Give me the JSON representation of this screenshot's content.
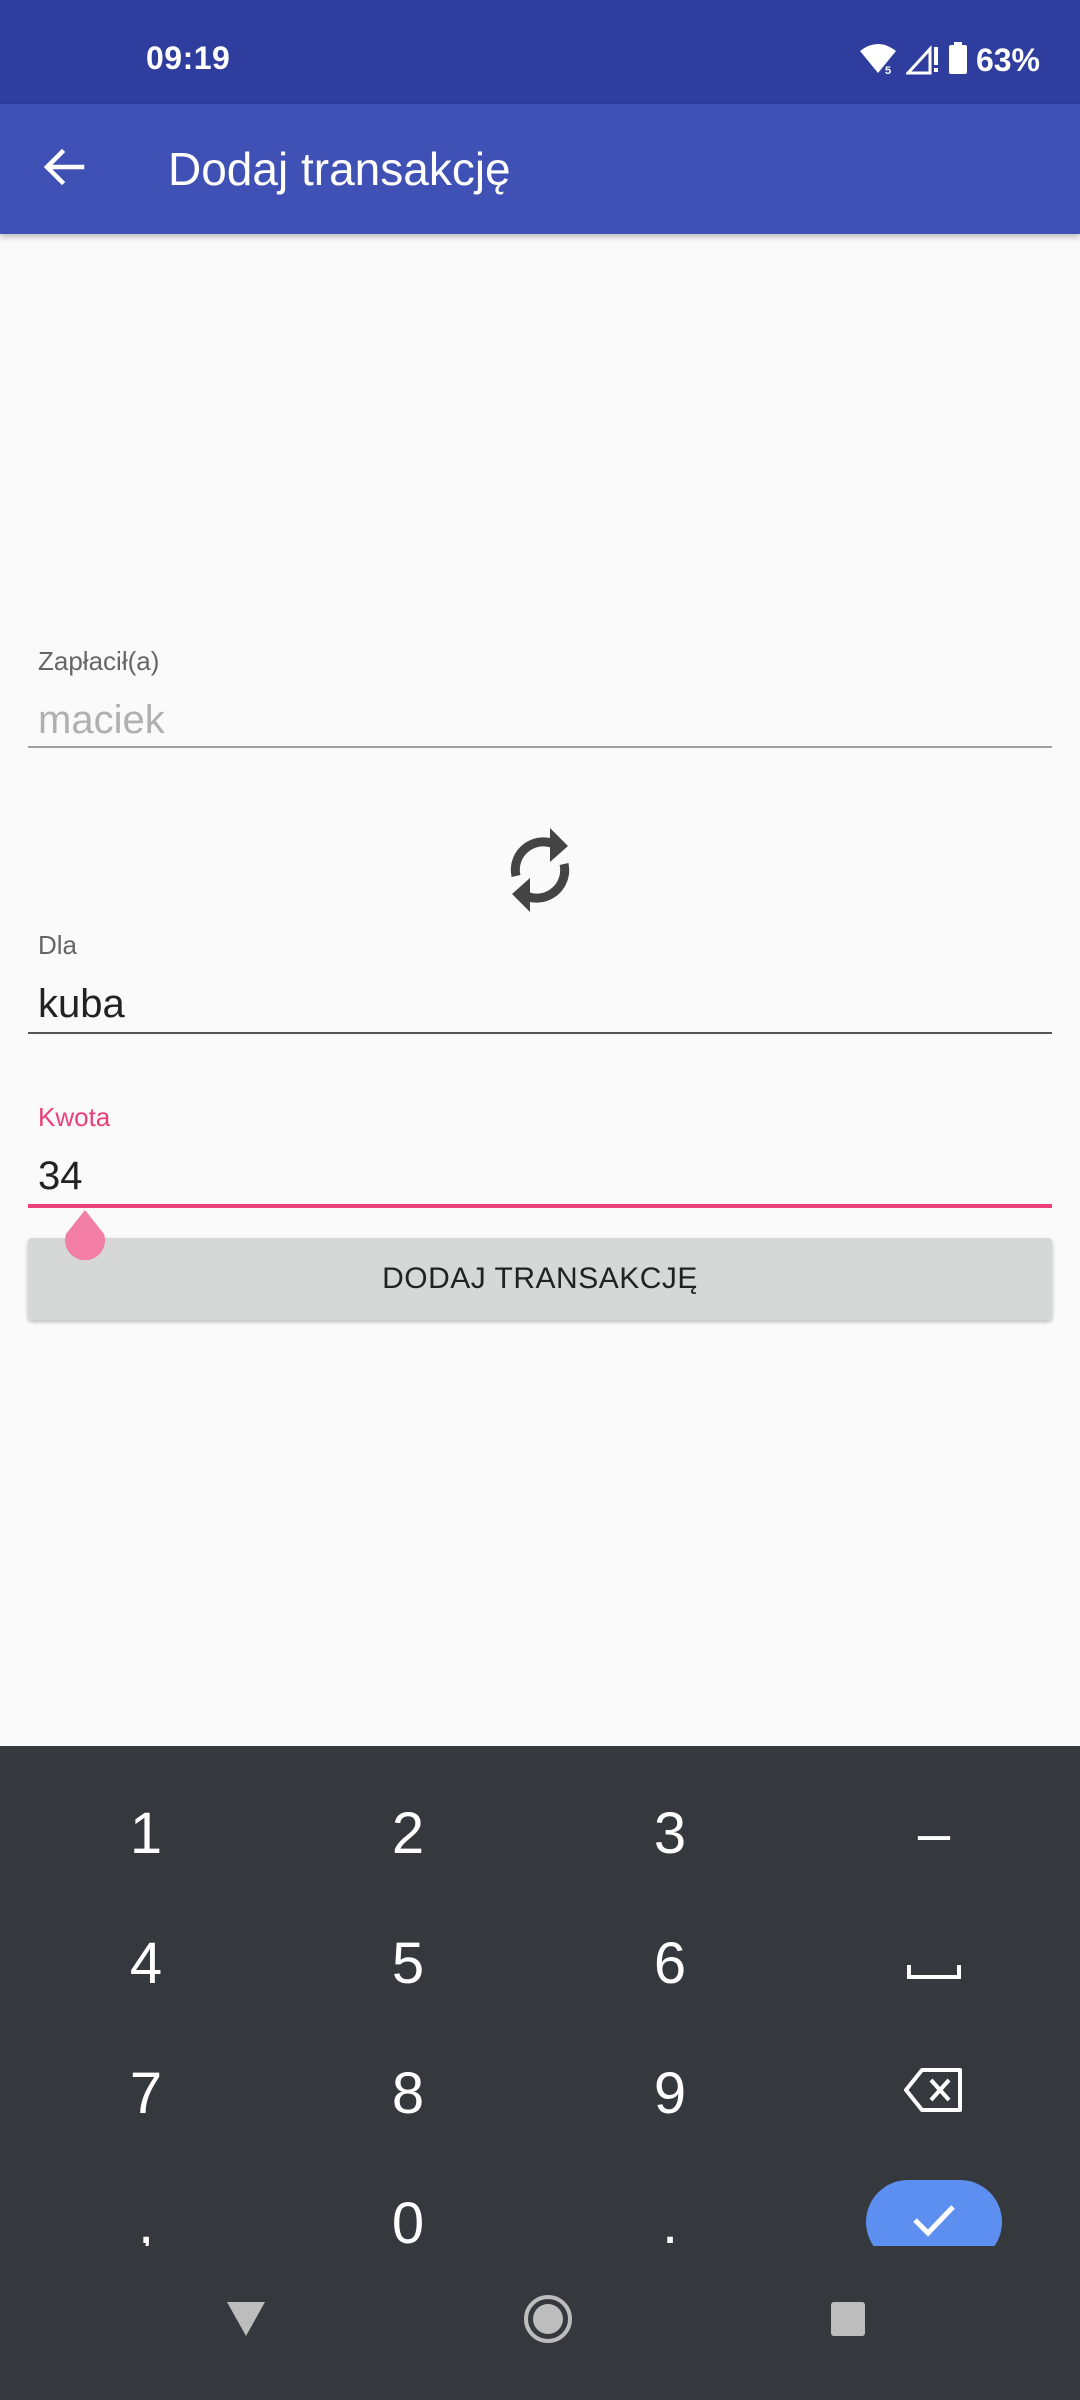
{
  "status": {
    "time": "09:19",
    "battery_pct": "63%",
    "icons": [
      "wifi-icon",
      "signal-icon",
      "battery-icon"
    ]
  },
  "appbar": {
    "back_icon": "arrow-back-icon",
    "title": "Dodaj transakcję"
  },
  "form": {
    "payer_label": "Zapłacił(a)",
    "payer_value": "maciek",
    "swap_icon": "swap-refresh-icon",
    "recipient_label": "Dla",
    "recipient_value": "kuba",
    "amount_label": "Kwota",
    "amount_value": "34",
    "submit_label": "DODAJ TRANSAKCJĘ"
  },
  "keyboard": {
    "rows": [
      [
        "1",
        "2",
        "3",
        "–"
      ],
      [
        "4",
        "5",
        "6",
        "space-icon"
      ],
      [
        "7",
        "8",
        "9",
        "backspace-icon"
      ],
      [
        ",",
        "0",
        ".",
        "done-check-icon"
      ]
    ]
  },
  "navbar": {
    "icons": [
      "back-triangle-icon",
      "home-circle-icon",
      "recents-square-icon"
    ]
  },
  "colors": {
    "statusbar": "#2e3d9e",
    "appbar": "#3f51b5",
    "accent": "#ec407a",
    "keyboard_bg": "#35393e",
    "done_key": "#5d8ff0"
  }
}
